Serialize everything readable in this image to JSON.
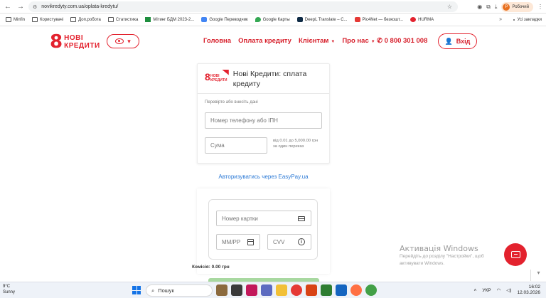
{
  "browser": {
    "url": "novikredyty.com.ua/oplata-kredytu/",
    "profile_label": "Робочий",
    "profile_initial": "Р",
    "bookmarks": [
      "Minfin",
      "Користувачі",
      "Доп.робота",
      "Статистика",
      "Мітинг БДМ 2023-2...",
      "Google Переводчик",
      "Google Карты",
      "DeepL Translate – С...",
      "Pic4Net — безкошт...",
      "HURMA"
    ],
    "bookmarks_more": "»",
    "all_bookmarks_label": "Усі закладки"
  },
  "header": {
    "logo_mark": "8",
    "logo_line1": "НОВІ",
    "logo_line2": "КРЕДИТИ",
    "nav": [
      "Головна",
      "Оплата кредиту",
      "Клієнтам",
      "Про нас"
    ],
    "phone": "0 800 301 008",
    "login_label": "Вхід"
  },
  "payment_form": {
    "title": "Нові Кредити: сплата кредиту",
    "hint": "Перевірте або внесіть дані",
    "phone_placeholder": "Номер телефону або ІПН",
    "sum_placeholder": "Сума",
    "sum_note": "від 0.01 до 5,000.00 грн за один переказ"
  },
  "easypay_link": "Авторизуватись через EasyPay.ua",
  "card_form": {
    "card_number_placeholder": "Номер картки",
    "expiry_placeholder": "ММ/РР",
    "cvv_placeholder": "CVV",
    "fee_label": "Комісія:",
    "fee_value": "0.00 грн"
  },
  "watermark": {
    "title": "Активація Windows",
    "subtitle": "Перейдіть до розділу \"Настройки\", щоб активувати Windows."
  },
  "taskbar": {
    "temperature": "9°C",
    "weather": "Sunny",
    "search_placeholder": "Пошук",
    "language": "УКР",
    "time": "16:02",
    "date": "12.03.2026"
  },
  "colors": {
    "brand_red": "#e3222e",
    "link_blue": "#2e7bd6"
  }
}
